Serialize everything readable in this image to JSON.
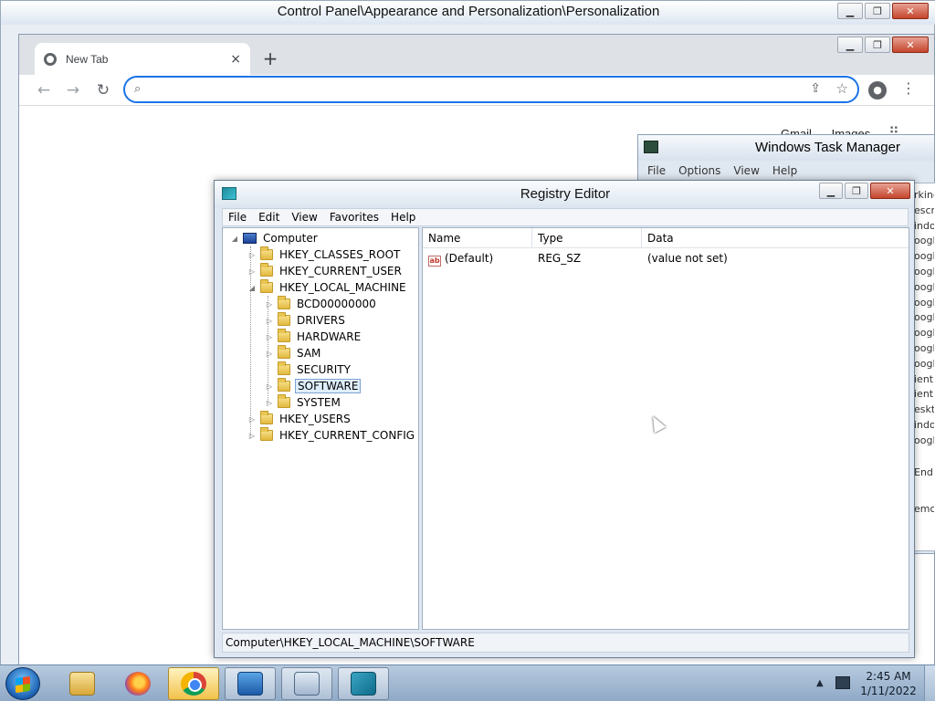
{
  "control_panel": {
    "title": "Control Panel\\Appearance and Personalization\\Personalization"
  },
  "chrome": {
    "tab_title": "New Tab",
    "tab_close": "×",
    "new_tab": "+",
    "omnibox_value": "",
    "omnibox_placeholder": "",
    "ntp_links": [
      "Gmail",
      "Images"
    ]
  },
  "task_manager": {
    "title": "Windows Task Manager",
    "menu": [
      "File",
      "Options",
      "View",
      "Help"
    ],
    "right_column_texts": [
      "rking",
      "escri",
      "indo",
      "oogle",
      "oogle",
      "oogle",
      "oogle",
      "oogle",
      "oogle",
      "oogle",
      "oogle",
      "oogle",
      "ient",
      "ient",
      "eskto",
      "indo",
      "oogle",
      "End",
      "emo"
    ]
  },
  "registry_editor": {
    "title": "Registry Editor",
    "menu": [
      "File",
      "Edit",
      "View",
      "Favorites",
      "Help"
    ],
    "tree": {
      "root": "Computer",
      "hives": [
        {
          "label": "HKEY_CLASSES_ROOT",
          "expander": "▷"
        },
        {
          "label": "HKEY_CURRENT_USER",
          "expander": "▷"
        },
        {
          "label": "HKEY_LOCAL_MACHINE",
          "expander": "◢"
        },
        {
          "label": "HKEY_USERS",
          "expander": "▷"
        },
        {
          "label": "HKEY_CURRENT_CONFIG",
          "expander": "▷"
        }
      ],
      "hklm_children": [
        {
          "label": "BCD00000000",
          "expander": "▷"
        },
        {
          "label": "DRIVERS",
          "expander": "▷"
        },
        {
          "label": "HARDWARE",
          "expander": "▷"
        },
        {
          "label": "SAM",
          "expander": "▷"
        },
        {
          "label": "SECURITY",
          "expander": ""
        },
        {
          "label": "SOFTWARE",
          "expander": "▷",
          "selected": true
        },
        {
          "label": "SYSTEM",
          "expander": "▷"
        }
      ]
    },
    "columns": {
      "name": "Name",
      "type": "Type",
      "data": "Data"
    },
    "values": [
      {
        "icon": "ab",
        "name": "(Default)",
        "type": "REG_SZ",
        "data": "(value not set)"
      }
    ],
    "status_path": "Computer\\HKEY_LOCAL_MACHINE\\SOFTWARE"
  },
  "taskbar": {
    "apps": [
      "explorer-icon",
      "firefox-icon",
      "chrome-icon",
      "control-panel-icon",
      "task-manager-icon",
      "regedit-icon"
    ],
    "tray_arrow": "▲",
    "clock_time": "2:45 AM",
    "clock_date": "1/11/2022"
  },
  "colors": {
    "accent": "#1a73e8",
    "selection_bg": "#dfeefc",
    "folder": "#e2b93e"
  }
}
